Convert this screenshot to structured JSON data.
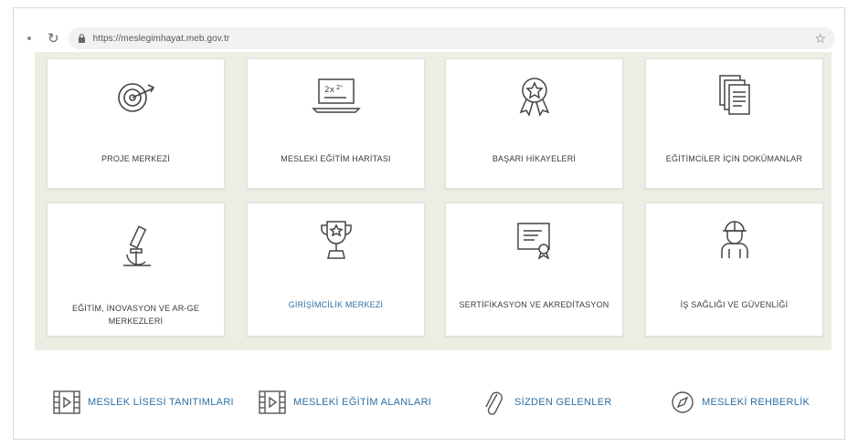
{
  "browser": {
    "url": "https://meslegimhayat.meb.gov.tr",
    "reload_icon": "reload-icon",
    "star_icon": "bookmark-star-icon"
  },
  "cards": [
    {
      "label": "PROJE MERKEZİ",
      "icon": "target-arrow-icon",
      "color": "default"
    },
    {
      "label": "MESLEKİ EĞİTİM HARİTASI",
      "icon": "laptop-chart-icon",
      "color": "default"
    },
    {
      "label": "BAŞARI HİKAYELERİ",
      "icon": "award-badge-icon",
      "color": "default"
    },
    {
      "label": "EĞİTİMCİLER İÇİN DOKÜMANLAR",
      "icon": "documents-stack-icon",
      "color": "default"
    },
    {
      "label": "EĞİTİM, İNOVASYON VE AR-GE MERKEZLERİ",
      "icon": "microscope-icon",
      "color": "default"
    },
    {
      "label": "GİRİŞİMCİLİK MERKEZİ",
      "icon": "trophy-star-icon",
      "color": "blue"
    },
    {
      "label": "SERTİFİKASYON ve AKREDİTASYON",
      "icon": "certificate-icon",
      "color": "default"
    },
    {
      "label": "İŞ SAĞLIĞI VE GÜVENLİĞİ",
      "icon": "worker-helmet-icon",
      "color": "default"
    }
  ],
  "bottom_links": [
    {
      "label": "MESLEK LİSESİ TANITIMLARI",
      "icon": "video-film-icon"
    },
    {
      "label": "MESLEKİ EĞİTİM ALANLARI",
      "icon": "video-film-icon"
    },
    {
      "label": "SİZDEN GELENLER",
      "icon": "paperclip-icon"
    },
    {
      "label": "MESLEKİ REHBERLİK",
      "icon": "compass-icon"
    }
  ],
  "colors": {
    "panel_bg": "#ebeee3",
    "link_blue": "#2e6fa3",
    "text_dark": "#3a3a3a"
  }
}
